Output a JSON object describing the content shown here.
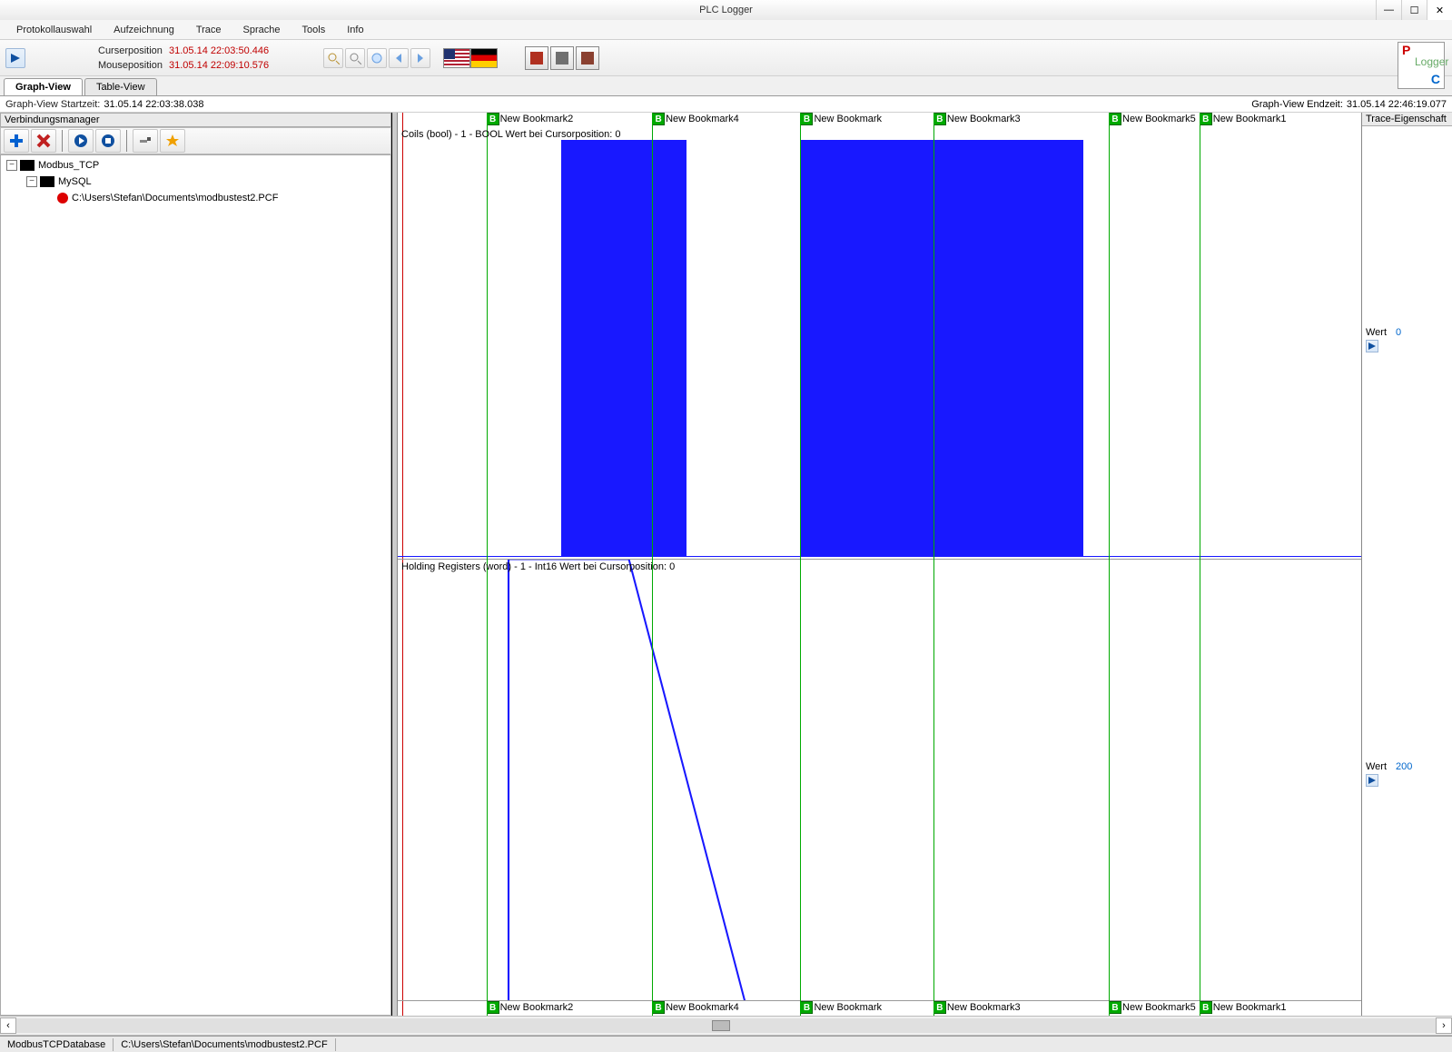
{
  "window": {
    "title": "PLC Logger"
  },
  "menubar": {
    "items": [
      "Protokollauswahl",
      "Aufzeichnung",
      "Trace",
      "Sprache",
      "Tools",
      "Info"
    ]
  },
  "toolbar": {
    "cursor_label": "Curserposition",
    "cursor_value": "31.05.14 22:03:50.446",
    "mouse_label": "Mouseposition",
    "mouse_value": "31.05.14 22:09:10.576"
  },
  "logo": {
    "p": "P",
    "l": "Logger",
    "c": "C"
  },
  "tabs": {
    "graph": "Graph-View",
    "table": "Table-View"
  },
  "time_strip": {
    "start_label": "Graph-View Startzeit:",
    "start_value": "31.05.14 22:03:38.038",
    "end_label": "Graph-View Endzeit:",
    "end_value": "31.05.14 22:46:19.077"
  },
  "left_pane": {
    "header": "Verbindungsmanager",
    "tree": {
      "root": "Modbus_TCP",
      "child": "MySQL",
      "file": "C:\\Users\\Stefan\\Documents\\modbustest2.PCF"
    }
  },
  "bookmarks": {
    "items": [
      {
        "label": "New Bookmark2",
        "x_pct": 9.2
      },
      {
        "label": "New Bookmark4",
        "x_pct": 26.4
      },
      {
        "label": "New Bookmark",
        "x_pct": 41.8
      },
      {
        "label": "New Bookmark3",
        "x_pct": 55.6
      },
      {
        "label": "New Bookmark5",
        "x_pct": 73.8
      },
      {
        "label": "New Bookmark1",
        "x_pct": 83.2
      }
    ]
  },
  "plots": {
    "plot1": {
      "title": "Coils (bool) - 1 - BOOL Wert bei Cursorposition: 0",
      "value_label": "Wert",
      "value": "0",
      "blocks": [
        {
          "left_pct": 17,
          "right_pct": 26.4
        },
        {
          "left_pct": 26.4,
          "right_pct": 30
        },
        {
          "left_pct": 41.8,
          "right_pct": 55.6
        },
        {
          "left_pct": 55.6,
          "right_pct": 71.2
        }
      ]
    },
    "plot2": {
      "title": "Holding Registers (word) - 1 - Int16 Wert bei Cursorposition: 0",
      "value_label": "Wert",
      "value": "200"
    }
  },
  "chart_data": [
    {
      "type": "area",
      "title": "Coils (bool) - 1 - BOOL",
      "x_range_pct": [
        0,
        100
      ],
      "segments": [
        {
          "from_pct": 17.0,
          "to_pct": 30.0,
          "value": 1
        },
        {
          "from_pct": 41.8,
          "to_pct": 71.2,
          "value": 1
        }
      ],
      "ylim": [
        0,
        1
      ],
      "cursor_x_pct": 0.5,
      "cursor_value": 0
    },
    {
      "type": "line",
      "title": "Holding Registers (word) - 1 - Int16",
      "points_pct": [
        {
          "x": 11.5,
          "y": 0
        },
        {
          "x": 11.5,
          "y": 100
        },
        {
          "x": 24.0,
          "y": 100
        },
        {
          "x": 36.0,
          "y": 0
        }
      ],
      "ylim": [
        0,
        100
      ],
      "cursor_x_pct": 0.5,
      "cursor_value": 0
    }
  ],
  "right_pane": {
    "header": "Trace-Eigenschaft"
  },
  "status": {
    "left": "ModbusTCPDatabase",
    "right": "C:\\Users\\Stefan\\Documents\\modbustest2.PCF"
  }
}
